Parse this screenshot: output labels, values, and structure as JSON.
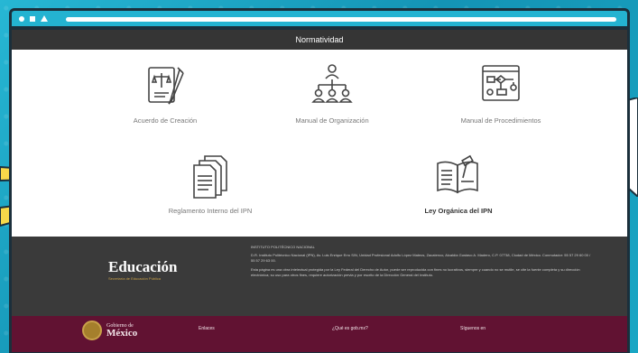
{
  "page": {
    "navbar_title": "Normatividad"
  },
  "cards": [
    {
      "label": "Acuerdo de Creación",
      "icon": "legal-document-icon",
      "bold": false
    },
    {
      "label": "Manual de Organización",
      "icon": "org-chart-icon",
      "bold": false
    },
    {
      "label": "Manual de Procedimientos",
      "icon": "flowchart-icon",
      "bold": false
    },
    {
      "label": "Reglamento Interno del IPN",
      "icon": "documents-icon",
      "bold": false
    },
    {
      "label": "Ley Orgánica del IPN",
      "icon": "law-book-icon",
      "bold": true
    }
  ],
  "footer": {
    "brand_title": "Educación",
    "brand_subtitle": "Secretaría de Educación Pública",
    "institution": "INSTITUTO POLITÉCNICO NACIONAL",
    "address": "D.R. Instituto Politécnico Nacional (IPN), Av. Luis Enrique Erro S/N, Unidad Profesional Adolfo López Mateos, Zacatenco, Alcaldía Gustavo A. Madero, C.P. 07738, Ciudad de México. Conmutador: 55 57 29 60 00 / 55 57 29 63 00.",
    "notice": "Esta página es una obra intelectual protegida por la Ley Federal del Derecho de Autor, puede ser reproducida con fines no lucrativos, siempre y cuando no se mutile, se cite la fuente completa y su dirección electrónica; su uso para otros fines, requiere autorización previa y por escrito de la Dirección General del Instituto."
  },
  "gob_footer": {
    "gobierno_small": "Gobierno de",
    "gobierno_big": "México",
    "enlaces": "Enlaces",
    "que_es": "¿Qué es gob.mx?",
    "siguenos": "Síguenos en"
  },
  "colors": {
    "background": "#1aa6c4",
    "navbar": "#353535",
    "footer_gray": "#3a3a3a",
    "footer_red": "#611232",
    "accent_gold": "#c9a14a"
  }
}
